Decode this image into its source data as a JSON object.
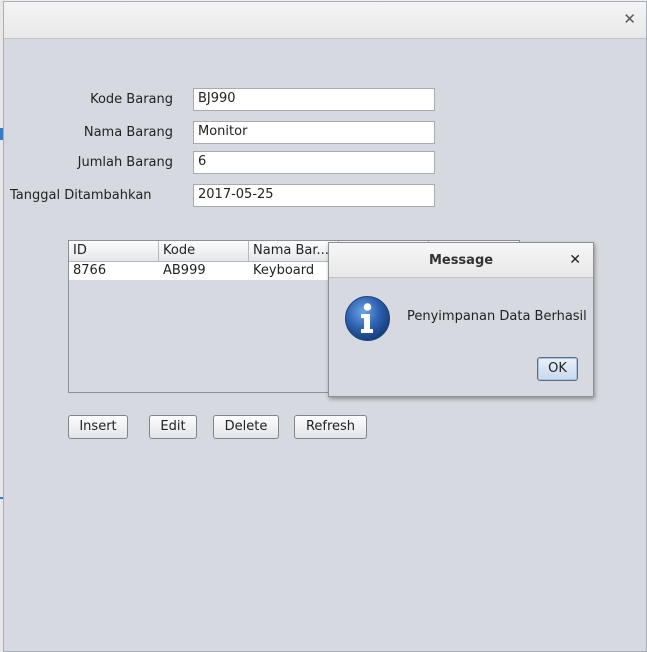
{
  "window": {
    "close_icon": "close-icon"
  },
  "form": {
    "kode_label": "Kode Barang",
    "kode_value": "BJ990",
    "nama_label": "Nama Barang",
    "nama_value": "Monitor",
    "jumlah_label": "Jumlah Barang",
    "jumlah_value": "6",
    "tanggal_label": "Tanggal Ditambahkan",
    "tanggal_value": "2017-05-25"
  },
  "table": {
    "headers": [
      "ID",
      "Kode",
      "Nama Bar...",
      "",
      ""
    ],
    "rows": [
      [
        "8766",
        "AB999",
        "Keyboard",
        "",
        ""
      ]
    ]
  },
  "buttons": {
    "insert": "Insert",
    "edit": "Edit",
    "delete": "Delete",
    "refresh": "Refresh"
  },
  "dialog": {
    "title": "Message",
    "close": "✕",
    "message": "Penyimpanan Data Berhasil",
    "ok": "OK",
    "icon": "info-icon"
  },
  "colors": {
    "frame_bg": "#d6d9df",
    "info_blue": "#2b5fae"
  }
}
